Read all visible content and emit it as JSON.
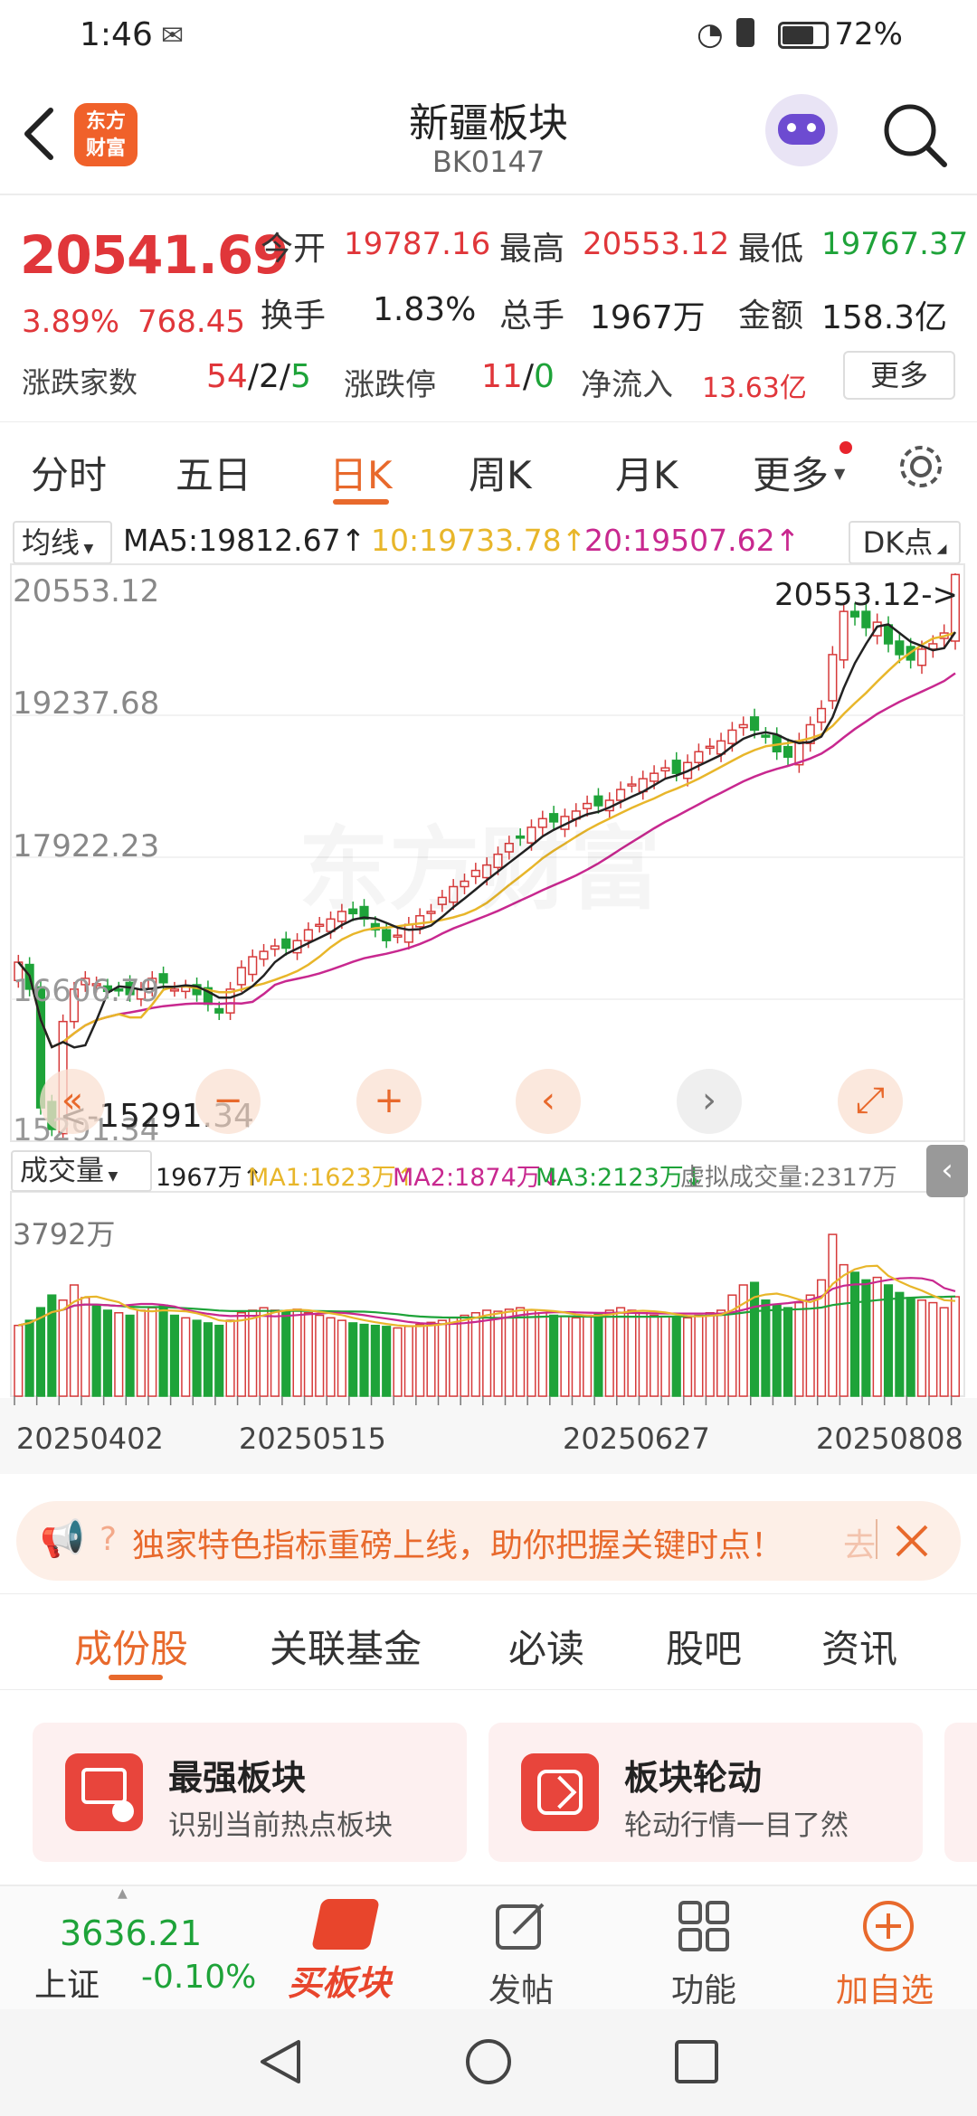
{
  "status_bar": {
    "time": "1:46",
    "battery": "72%"
  },
  "header": {
    "logo_text_1": "东方",
    "logo_text_2": "财富",
    "title": "新疆板块",
    "code": "BK0147"
  },
  "quote": {
    "price": "20541.69",
    "change_pct": "3.89%",
    "change_abs": "768.45",
    "open_label": "今开",
    "open": "19787.16",
    "high_label": "最高",
    "high": "20553.12",
    "low_label": "最低",
    "low": "19767.37",
    "turnover_label": "换手",
    "turnover": "1.83%",
    "volume_label": "总手",
    "volume": "1967万",
    "amount_label": "金额",
    "amount": "158.3亿",
    "updown_label": "涨跌家数",
    "up": "54",
    "flat": "2",
    "down": "5",
    "limit_label": "涨跌停",
    "limit_up": "11",
    "limit_down": "0",
    "inflow_label": "净流入",
    "inflow": "13.63亿",
    "more_button": "更多"
  },
  "period_tabs": [
    {
      "label": "分时",
      "active": false
    },
    {
      "label": "五日",
      "active": false
    },
    {
      "label": "日K",
      "active": true
    },
    {
      "label": "周K",
      "active": false
    },
    {
      "label": "月K",
      "active": false
    },
    {
      "label": "更多",
      "active": false
    }
  ],
  "ma_bar": {
    "selector": "均线",
    "ma5": "MA5:19812.67↑",
    "ma10": "10:19733.78↑",
    "ma20": "20:19507.62↑",
    "dk_button": "DK点",
    "color_ma5": "#222222",
    "color_ma10": "#e8b62a",
    "color_ma20": "#c8288f"
  },
  "price_axis": {
    "labels": [
      "20553.12",
      "19237.68",
      "17922.23",
      "16606.79",
      "15291.34"
    ],
    "max_annotation": "20553.12->",
    "min_annotation": "<-15291.34",
    "watermark": "东方财富"
  },
  "vol_bar": {
    "selector": "成交量",
    "vol": "1967万↑",
    "ma1": "MA1:1623万↑",
    "ma2": "MA2:1874万↓",
    "ma3": "MA3:2123万↓",
    "virtual": "虚拟成交量:2317万",
    "axis_max": "3792万"
  },
  "date_axis": [
    "20250402",
    "20250515",
    "20250627",
    "20250808"
  ],
  "chart_data": {
    "type": "candlestick",
    "price_range": [
      15291.34,
      20553.12
    ],
    "closes": [
      16950,
      16700,
      15600,
      15400,
      16400,
      16700,
      16800,
      16750,
      16680,
      16700,
      16650,
      16700,
      16800,
      16760,
      16700,
      16720,
      16650,
      16560,
      16480,
      16700,
      16900,
      17000,
      17050,
      17100,
      17080,
      17150,
      17250,
      17300,
      17350,
      17420,
      17400,
      17350,
      17250,
      17150,
      17200,
      17300,
      17380,
      17420,
      17550,
      17650,
      17700,
      17800,
      17850,
      17950,
      18050,
      18100,
      18200,
      18280,
      18250,
      18300,
      18350,
      18420,
      18400,
      18450,
      18550,
      18600,
      18650,
      18700,
      18750,
      18700,
      18800,
      18900,
      18950,
      19000,
      19100,
      19150,
      19100,
      19050,
      18900,
      18850,
      19000,
      19150,
      19300,
      19800,
      20200,
      20150,
      20050,
      20100,
      19900,
      19800,
      19750,
      19850,
      19900,
      20000,
      20541.69
    ],
    "volumes": [
      1400,
      1500,
      1750,
      2000,
      1900,
      2200,
      1950,
      1800,
      1700,
      1650,
      1600,
      1700,
      1750,
      1800,
      1600,
      1550,
      1500,
      1450,
      1400,
      1500,
      1650,
      1700,
      1750,
      1700,
      1680,
      1720,
      1650,
      1600,
      1550,
      1500,
      1450,
      1420,
      1400,
      1380,
      1350,
      1380,
      1420,
      1460,
      1500,
      1550,
      1600,
      1650,
      1700,
      1680,
      1720,
      1750,
      1700,
      1650,
      1600,
      1580,
      1550,
      1600,
      1650,
      1700,
      1750,
      1700,
      1650,
      1600,
      1580,
      1560,
      1550,
      1600,
      1650,
      1700,
      2000,
      2200,
      2250,
      1900,
      1800,
      1750,
      1850,
      2000,
      2300,
      3200,
      2600,
      2450,
      2300,
      2350,
      2200,
      2050,
      1950,
      1900,
      1850,
      1750,
      1967
    ],
    "vol_max": 3792
  },
  "chart_buttons": [
    "«",
    "−",
    "+",
    "‹",
    "›",
    "⤢"
  ],
  "promo": {
    "text": "独家特色指标重磅上线，助你把握关键时点！",
    "tail": "去"
  },
  "sub_tabs": [
    "成份股",
    "关联基金",
    "必读",
    "股吧",
    "资讯"
  ],
  "cards": [
    {
      "title": "最强板块",
      "sub": "识别当前热点板块"
    },
    {
      "title": "板块轮动",
      "sub": "轮动行情一目了然"
    }
  ],
  "bottom": {
    "index_value": "3636.21",
    "index_name": "上证",
    "index_change": "-0.10%",
    "buy_label": "买板块",
    "post_label": "发帖",
    "func_label": "功能",
    "add_label": "加自选"
  }
}
